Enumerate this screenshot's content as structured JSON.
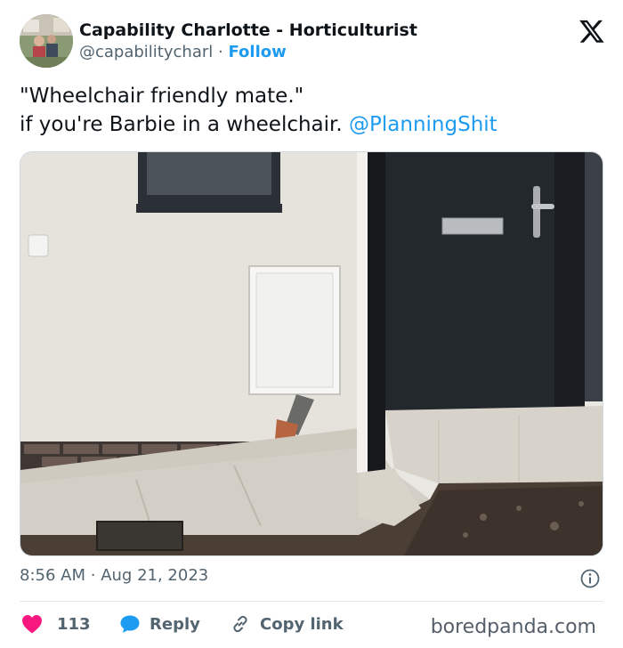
{
  "author": {
    "display_name": "Capability Charlotte - Horticulturist",
    "handle": "@capabilitycharl",
    "separator": "·",
    "follow_label": "Follow",
    "avatar_icon": "profile-photo"
  },
  "brand": {
    "logo_icon": "x-logo-icon"
  },
  "tweet": {
    "line1": "\"Wheelchair friendly mate.\"",
    "line2_prefix": "if you're Barbie in a wheelchair. ",
    "mention": "@PlanningShit"
  },
  "media": {
    "type": "photo",
    "icon": "photo-of-house-entrance-with-step"
  },
  "meta": {
    "time": "8:56 AM",
    "separator": "·",
    "date": "Aug 21, 2023",
    "info_icon": "info-icon"
  },
  "actions": {
    "like_count": "113",
    "reply_label": "Reply",
    "copy_label": "Copy link"
  },
  "watermark": "boredpanda.com",
  "colors": {
    "accent": "#1d9bf0",
    "like": "#f91880",
    "text": "#0f1419",
    "muted": "#536471"
  }
}
